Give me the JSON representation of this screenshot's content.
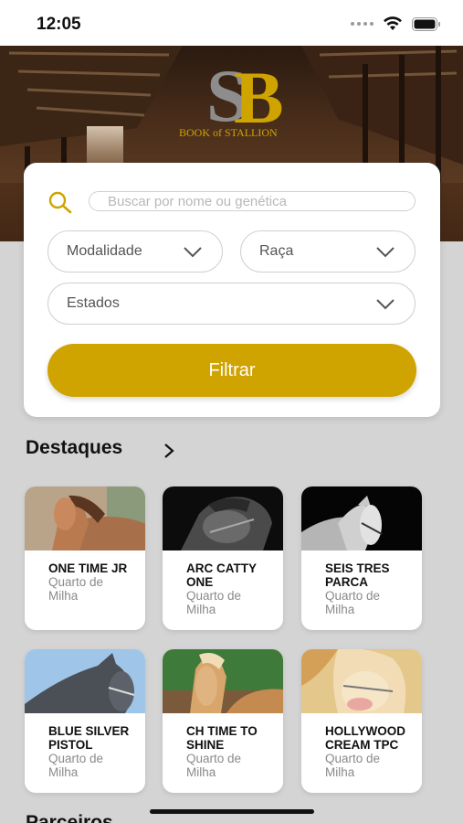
{
  "status_bar": {
    "time": "12:05"
  },
  "brand": {
    "monogram": "SB",
    "name": "BOOK of STALLION",
    "accent": "#cfa300"
  },
  "search": {
    "placeholder": "Buscar por nome ou genética",
    "modalidade_label": "Modalidade",
    "raca_label": "Raça",
    "estados_label": "Estados",
    "filter_button": "Filtrar"
  },
  "featured": {
    "title": "Destaques",
    "items": [
      {
        "name": "ONE TIME JR",
        "breed": "Quarto de Milha"
      },
      {
        "name": "ARC CATTY ONE",
        "breed": "Quarto de Milha"
      },
      {
        "name": "SEIS TRES PARCA",
        "breed": "Quarto de Milha"
      },
      {
        "name": "BLUE SILVER PISTOL",
        "breed": "Quarto de Milha"
      },
      {
        "name": "CH TIME TO SHINE",
        "breed": "Quarto de Milha"
      },
      {
        "name": "HOLLYWOOD CREAM TPC",
        "breed": "Quarto de Milha"
      }
    ]
  },
  "partners": {
    "title": "Parceiros"
  },
  "icons": [
    "search-icon",
    "chevron-down-icon",
    "chevron-right-icon",
    "wifi-icon",
    "battery-icon",
    "signal-icon"
  ]
}
